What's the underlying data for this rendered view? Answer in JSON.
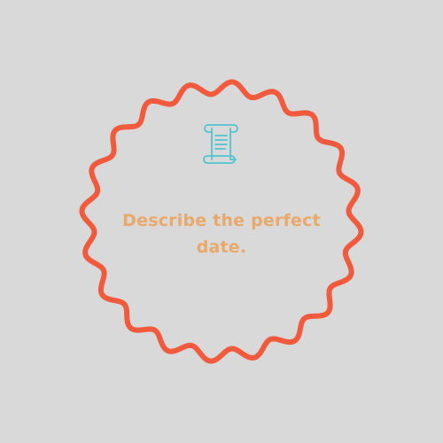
{
  "prompt": {
    "text": "Describe the perfect date."
  },
  "icon": {
    "name": "scroll-icon"
  },
  "colors": {
    "background": "#d9d9d9",
    "ring": "#f15a3c",
    "icon": "#4fc3cf",
    "text": "#e8a96a"
  }
}
